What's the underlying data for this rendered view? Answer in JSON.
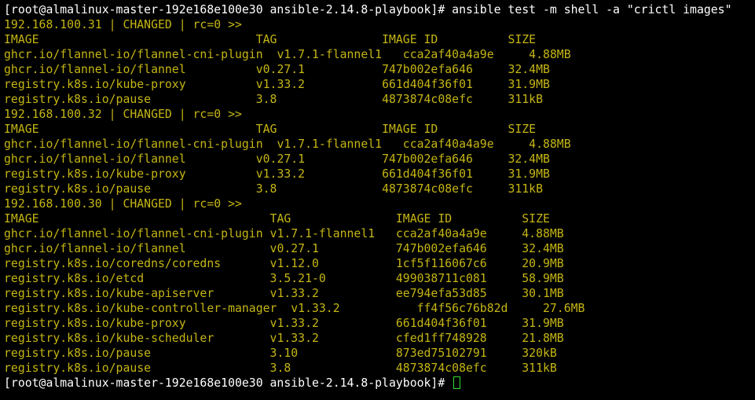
{
  "terminal": {
    "prompt": "[root@almalinux-master-192e168e100e30 ansible-2.14.8-playbook]# ",
    "command": "ansible test -m shell -a \"crictl images\"",
    "hosts": [
      {
        "status": "192.168.100.31 | CHANGED | rc=0 >>",
        "widths": [
          36,
          18,
          18
        ],
        "header": [
          "IMAGE",
          "TAG",
          "IMAGE ID",
          "SIZE"
        ],
        "rows": [
          [
            "ghcr.io/flannel-io/flannel-cni-plugin",
            "v1.7.1-flannel1",
            "cca2af40a4a9e",
            "4.88MB"
          ],
          [
            "ghcr.io/flannel-io/flannel",
            "v0.27.1",
            "747b002efa646",
            "32.4MB"
          ],
          [
            "registry.k8s.io/kube-proxy",
            "v1.33.2",
            "661d404f36f01",
            "31.9MB"
          ],
          [
            "registry.k8s.io/pause",
            "3.8",
            "4873874c08efc",
            "311kB"
          ]
        ]
      },
      {
        "status": "192.168.100.32 | CHANGED | rc=0 >>",
        "widths": [
          36,
          18,
          18
        ],
        "header": [
          "IMAGE",
          "TAG",
          "IMAGE ID",
          "SIZE"
        ],
        "rows": [
          [
            "ghcr.io/flannel-io/flannel-cni-plugin",
            "v1.7.1-flannel1",
            "cca2af40a4a9e",
            "4.88MB"
          ],
          [
            "ghcr.io/flannel-io/flannel",
            "v0.27.1",
            "747b002efa646",
            "32.4MB"
          ],
          [
            "registry.k8s.io/kube-proxy",
            "v1.33.2",
            "661d404f36f01",
            "31.9MB"
          ],
          [
            "registry.k8s.io/pause",
            "3.8",
            "4873874c08efc",
            "311kB"
          ]
        ]
      },
      {
        "status": "192.168.100.30 | CHANGED | rc=0 >>",
        "widths": [
          38,
          18,
          18
        ],
        "header": [
          "IMAGE",
          "TAG",
          "IMAGE ID",
          "SIZE"
        ],
        "rows": [
          [
            "ghcr.io/flannel-io/flannel-cni-plugin",
            "v1.7.1-flannel1",
            "cca2af40a4a9e",
            "4.88MB"
          ],
          [
            "ghcr.io/flannel-io/flannel",
            "v0.27.1",
            "747b002efa646",
            "32.4MB"
          ],
          [
            "registry.k8s.io/coredns/coredns",
            "v1.12.0",
            "1cf5f116067c6",
            "20.9MB"
          ],
          [
            "registry.k8s.io/etcd",
            "3.5.21-0",
            "499038711c081",
            "58.9MB"
          ],
          [
            "registry.k8s.io/kube-apiserver",
            "v1.33.2",
            "ee794efa53d85",
            "30.1MB"
          ],
          [
            "registry.k8s.io/kube-controller-manager",
            "v1.33.2",
            "ff4f56c76b82d",
            "27.6MB"
          ],
          [
            "registry.k8s.io/kube-proxy",
            "v1.33.2",
            "661d404f36f01",
            "31.9MB"
          ],
          [
            "registry.k8s.io/kube-scheduler",
            "v1.33.2",
            "cfed1ff748928",
            "21.8MB"
          ],
          [
            "registry.k8s.io/pause",
            "3.10",
            "873ed75102791",
            "320kB"
          ],
          [
            "registry.k8s.io/pause",
            "3.8",
            "4873874c08efc",
            "311kB"
          ]
        ]
      }
    ],
    "final_prompt": "[root@almalinux-master-192e168e100e30 ansible-2.14.8-playbook]# ",
    "colors": {
      "background": "#000000",
      "prompt": "#ffffff",
      "output": "#c4b513",
      "cursor": "#33dd33"
    }
  }
}
